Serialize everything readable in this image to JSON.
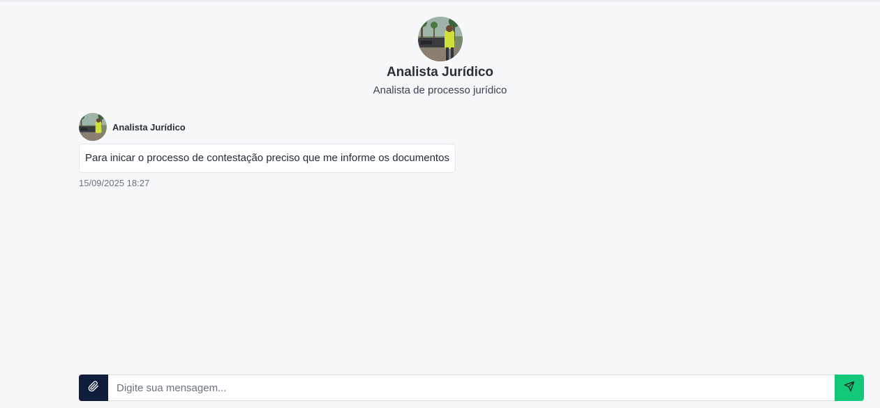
{
  "agent": {
    "name": "Analista Jurídico",
    "role": "Analista de processo jurídico",
    "avatar_icon": "agent-photo-avatar"
  },
  "messages": [
    {
      "sender": "Analista Jurídico",
      "text": "Para inicar o processo de contestação preciso que me informe os documentos",
      "timestamp": "15/09/2025 18:27"
    }
  ],
  "composer": {
    "placeholder": "Digite sua mensagem...",
    "value": "",
    "attach_icon": "paperclip-icon",
    "send_icon": "send-icon"
  },
  "colors": {
    "background": "#f7f8fa",
    "attach_button": "#101c3c",
    "send_button": "#12c97a"
  }
}
